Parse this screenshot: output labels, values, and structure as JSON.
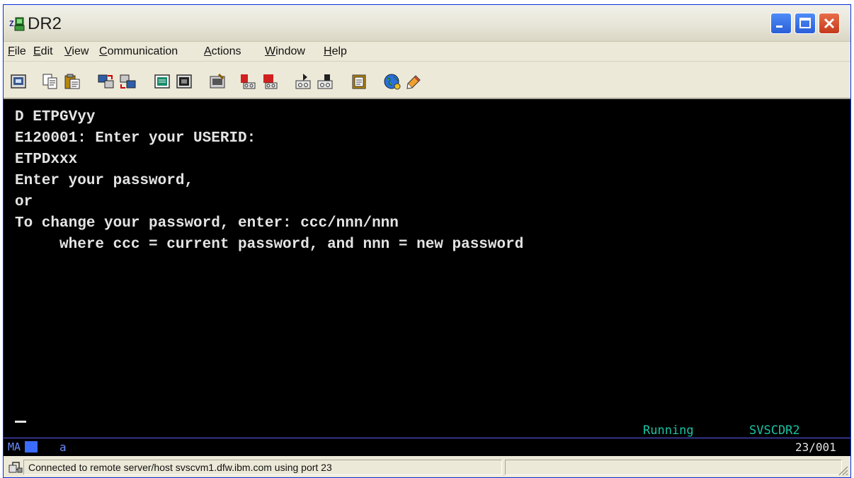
{
  "window": {
    "title": "DR2"
  },
  "menu": {
    "file": {
      "acc": "F",
      "rest": "ile"
    },
    "edit": {
      "acc": "E",
      "rest": "dit"
    },
    "view": {
      "acc": "V",
      "rest": "iew"
    },
    "communication": {
      "acc": "C",
      "rest": "ommunication"
    },
    "actions": {
      "acc": "A",
      "rest": "ctions"
    },
    "window": {
      "acc": "W",
      "rest": "indow"
    },
    "help": {
      "acc": "H",
      "rest": "elp"
    }
  },
  "toolbar": {
    "icons": [
      "print-screen-icon",
      "copy-icon",
      "paste-icon",
      "send-icon",
      "receive-icon",
      "display-icon",
      "keypad-icon",
      "macro-icon",
      "record-icon",
      "stop-icon",
      "play-icon",
      "pause-icon",
      "clipboard-icon",
      "globe-icon",
      "edit-icon"
    ]
  },
  "terminal": {
    "lines": [
      "D ETPGVyy",
      "E120001: Enter your USERID:",
      "ETPDxxx",
      "Enter your password,",
      "or",
      "To change your password, enter: ccc/nnn/nnn",
      "     where ccc = current password, and nnn = new password"
    ],
    "status_running": "Running",
    "session_name": "SVSCDR2"
  },
  "oia": {
    "mode": "MA",
    "indicator": "a",
    "cursor_pos": "23/001"
  },
  "statusbar": {
    "text": "Connected to remote server/host svscvm1.dfw.ibm.com using port 23"
  },
  "colors": {
    "terminal_bg": "#000000",
    "terminal_fg": "#e4e4e4",
    "oia_accent": "#19c2a4",
    "titlebar_close": "#c4391b"
  }
}
